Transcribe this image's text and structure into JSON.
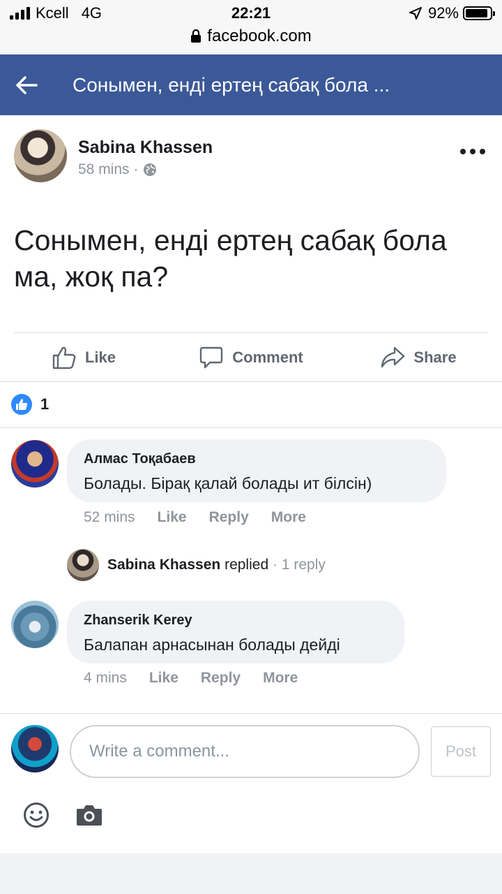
{
  "status_bar": {
    "carrier": "Kcell",
    "network": "4G",
    "time": "22:21",
    "battery": "92%",
    "battery_level": 0.92,
    "url": "facebook.com"
  },
  "app_bar": {
    "title": "Сонымен, енді ертең сабақ бола ..."
  },
  "post": {
    "author": "Sabina Khassen",
    "time": "58 mins",
    "separator": "·",
    "text": "Сонымен, енді ертең сабақ бола ма, жоқ па?",
    "reaction_count": "1"
  },
  "actions": {
    "like": "Like",
    "comment": "Comment",
    "share": "Share"
  },
  "comments": [
    {
      "name": "Алмас Тоқабаев",
      "text": "Болады. Бірақ қалай болады ит білсін)",
      "time": "52 mins",
      "like": "Like",
      "reply": "Reply",
      "more": "More"
    },
    {
      "name": "Zhanserik Kerey",
      "text": "Балапан арнасынан болады дейді",
      "time": "4 mins",
      "like": "Like",
      "reply": "Reply",
      "more": "More"
    }
  ],
  "reply_summary": {
    "name": "Sabina Khassen",
    "word": "replied",
    "separator": "·",
    "count": "1 reply"
  },
  "composer": {
    "placeholder": "Write a comment...",
    "post_label": "Post"
  },
  "colors": {
    "brand": "#3b5998",
    "like_blue": "#2e89ff",
    "meta_gray": "#90949c"
  }
}
